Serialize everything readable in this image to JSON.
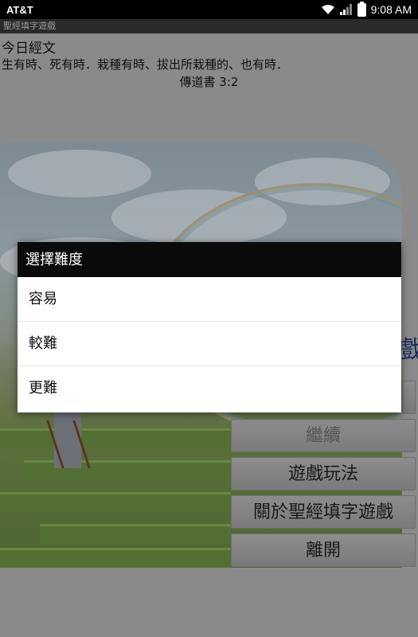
{
  "status_bar": {
    "carrier": "AT&T",
    "time": "9:08 AM",
    "icons": [
      "wifi-icon",
      "signal-icon",
      "battery-icon"
    ]
  },
  "app": {
    "title": "聖經填字遊戲"
  },
  "verse": {
    "heading": "今日經文",
    "text": "生有時、死有時．栽種有時、拔出所栽種的、也有時．",
    "reference": "傳道書 3:2"
  },
  "side_title_fragment": "戲",
  "menu": {
    "continue": "繼續",
    "how_to_play": "遊戲玩法",
    "about": "關於聖經填字遊戲",
    "exit": "離開"
  },
  "dialog": {
    "title": "選擇難度",
    "options": [
      "容易",
      "較難",
      "更難"
    ]
  },
  "colors": {
    "dialog_title_bg": "#0a0a0a",
    "side_title": "#1c2b5e"
  }
}
